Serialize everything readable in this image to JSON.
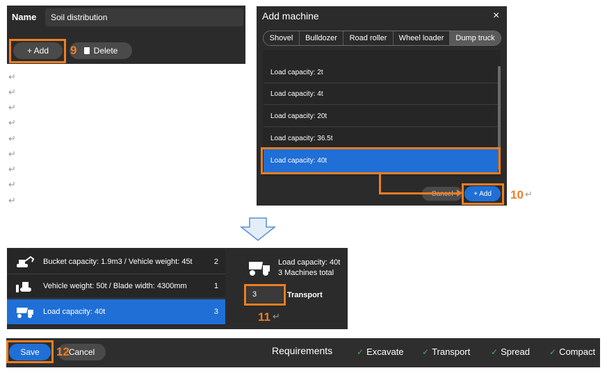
{
  "top_panel": {
    "name_label": "Name",
    "name_value": "Soil distribution",
    "add_label": "+ Add",
    "delete_label": "Delete"
  },
  "steps": {
    "s9": "9",
    "s10": "10",
    "s11": "11",
    "s12": "12"
  },
  "dialog": {
    "title": "Add machine",
    "close": "×",
    "tabs": [
      "Shovel",
      "Bulldozer",
      "Road roller",
      "Wheel loader",
      "Dump truck"
    ],
    "items": [
      "Load capacity: 2t",
      "Load capacity: 4t",
      "Load capacity: 20t",
      "Load capacity: 36.5t",
      "Load capacity: 40t"
    ],
    "cancel_label": "Cancel",
    "add_label": "+ Add"
  },
  "machine_list": [
    {
      "label": "Bucket capacity: 1.9m3 / Vehicle weight: 45t",
      "count": "2",
      "icon": "excavator-icon"
    },
    {
      "label": "Vehicle weight: 50t / Blade width: 4300mm",
      "count": "1",
      "icon": "bulldozer-icon"
    },
    {
      "label": "Load capacity: 40t",
      "count": "3",
      "icon": "dump-truck-icon"
    }
  ],
  "detail": {
    "title": "Load capacity: 40t",
    "subtitle": "3 Machines total",
    "quantity": "3",
    "role": "Transport"
  },
  "bottom_bar": {
    "save_label": "Save",
    "cancel_label": "Cancel",
    "requirements_label": "Requirements",
    "requirements": [
      "Excavate",
      "Transport",
      "Spread",
      "Compact"
    ]
  },
  "colors": {
    "accent": "#1f6fd6",
    "callout": "#ef7d22",
    "dark": "#2b2b2b"
  }
}
